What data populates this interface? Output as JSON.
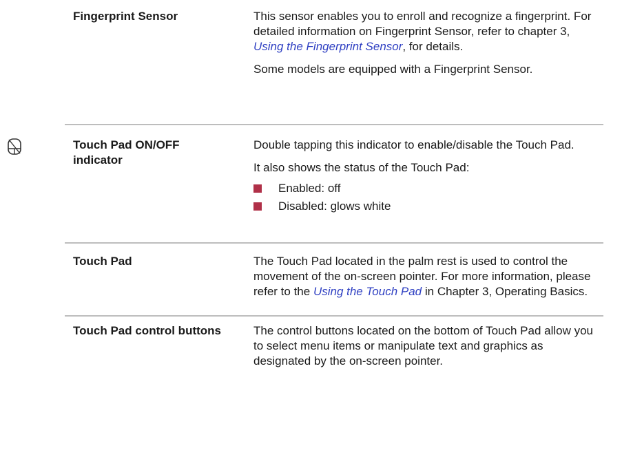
{
  "rows": [
    {
      "term": "Fingerprint Sensor",
      "p1_a": "This sensor enables you to enroll and recognize a fingerprint. For detailed information on Fingerprint Sensor, refer to chapter 3, ",
      "p1_link": "Using the Fingerprint Sensor",
      "p1_b": ", for details.",
      "p2": "Some models are equipped with a Fingerprint Sensor."
    },
    {
      "term": "Touch Pad ON/OFF indicator",
      "p1": "Double tapping this indicator to enable/disable the Touch Pad.",
      "p2": "It also shows the status of the Touch Pad:",
      "bullets": [
        "Enabled: off",
        "Disabled: glows white"
      ]
    },
    {
      "term": "Touch Pad",
      "p1_a": "The Touch Pad located in the palm rest is used to control the movement of the on-screen pointer. For more information, please refer to the ",
      "p1_link": "Using the Touch Pad",
      "p1_b": " in Chapter 3, Operating Basics."
    },
    {
      "term": "Touch Pad control buttons",
      "p1": "The control buttons located on the bottom of Touch Pad allow you to select menu items or manipulate text and graphics as designated by the on-screen pointer."
    }
  ],
  "colors": {
    "bullet": "#b03048",
    "link": "#2e3fc2",
    "rule": "#bdbdbd"
  },
  "icons": {
    "side": "touchpad-indicator-icon"
  }
}
